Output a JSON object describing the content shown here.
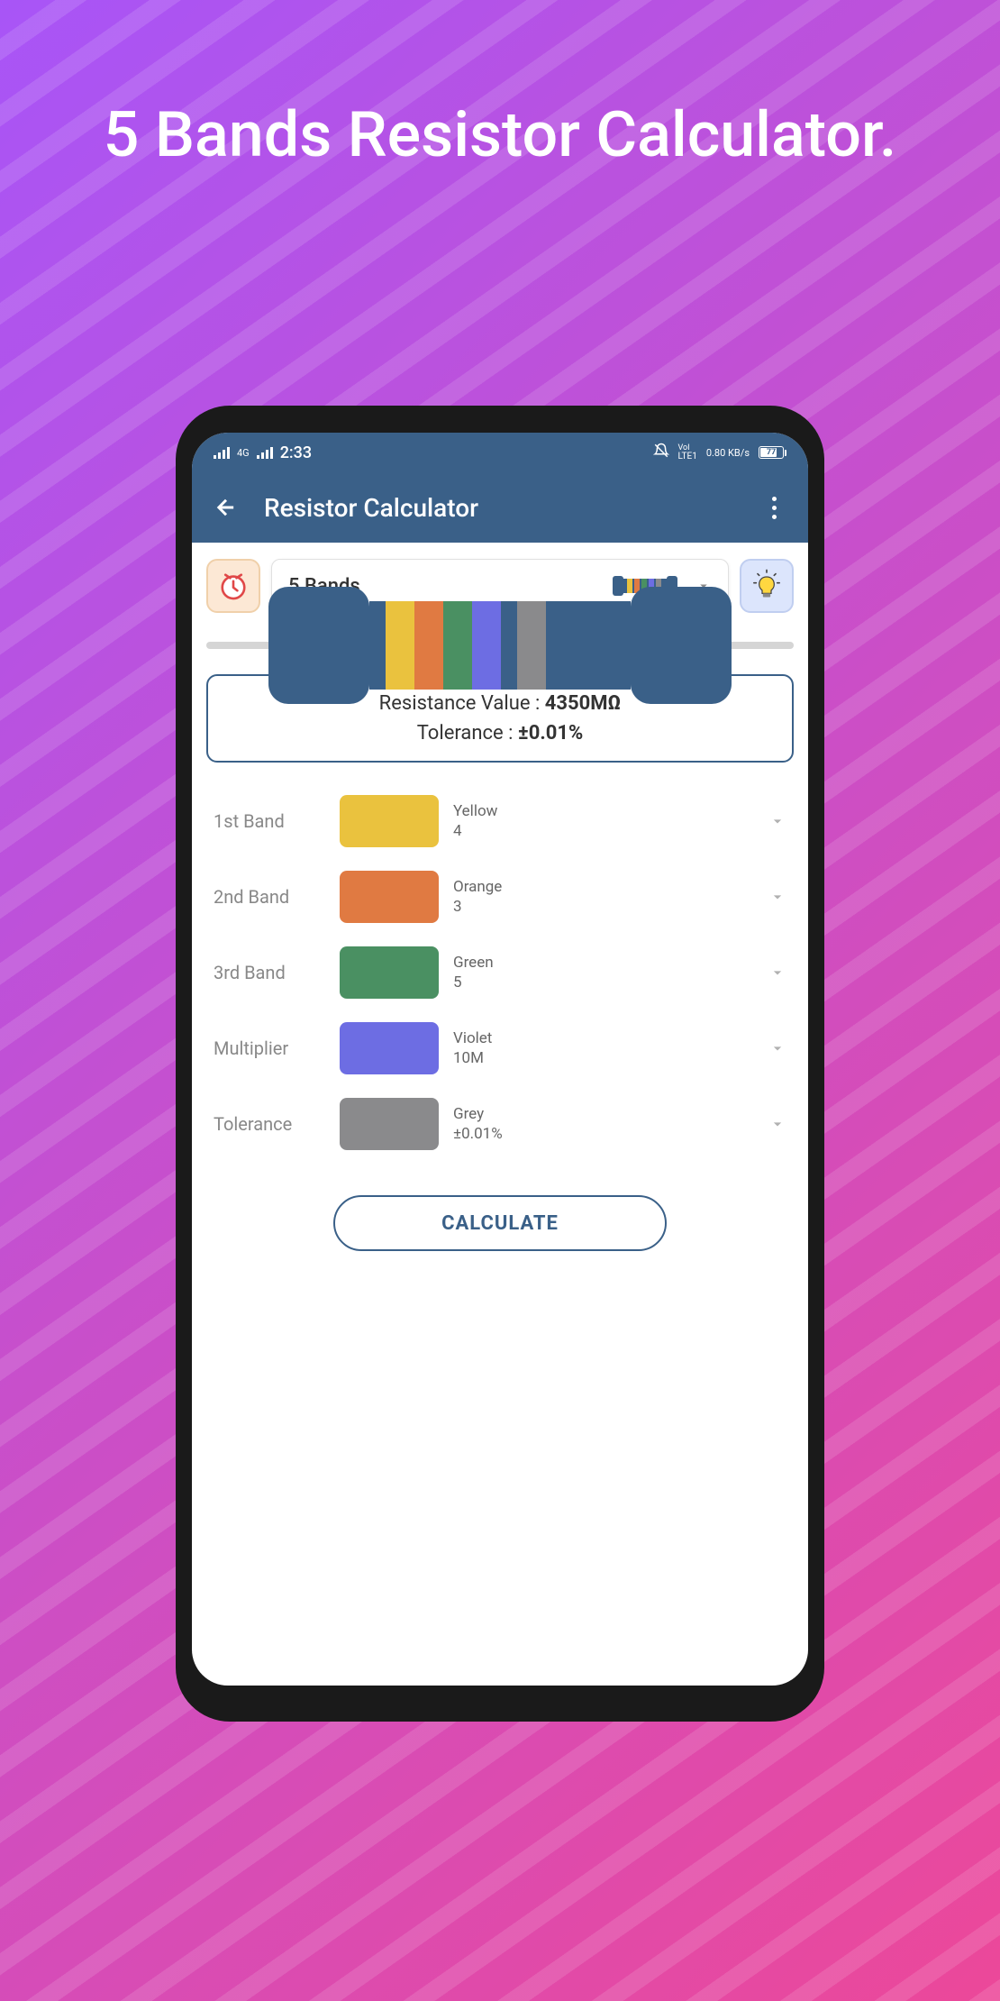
{
  "promo": {
    "title": "5 Bands Resistor Calculator."
  },
  "status": {
    "time": "2:33",
    "net_label": "4G",
    "lte_label": "LTE1",
    "speed": "0.80 KB/s",
    "battery": "77"
  },
  "app": {
    "title": "Resistor Calculator",
    "bands_selector": "5 Bands"
  },
  "result": {
    "resistance_label": "Resistance Value : ",
    "resistance_value": "4350MΩ",
    "tolerance_label": "Tolerance : ",
    "tolerance_value": "±0.01%"
  },
  "bands": [
    {
      "label": "1st Band",
      "color": "#eac23e",
      "name": "Yellow",
      "value": "4"
    },
    {
      "label": "2nd Band",
      "color": "#e07a42",
      "name": "Orange",
      "value": "3"
    },
    {
      "label": "3rd Band",
      "color": "#4a9062",
      "name": "Green",
      "value": "5"
    },
    {
      "label": "Multiplier",
      "color": "#6d6de3",
      "name": "Violet",
      "value": "10M"
    },
    {
      "label": "Tolerance",
      "color": "#8a8a8c",
      "name": "Grey",
      "value": "±0.01%"
    }
  ],
  "calculate_label": "CALCULATE",
  "mini_bands": [
    "#eac23e",
    "#e07a42",
    "#4a9062",
    "#6d6de3",
    "#8a8a8c"
  ]
}
